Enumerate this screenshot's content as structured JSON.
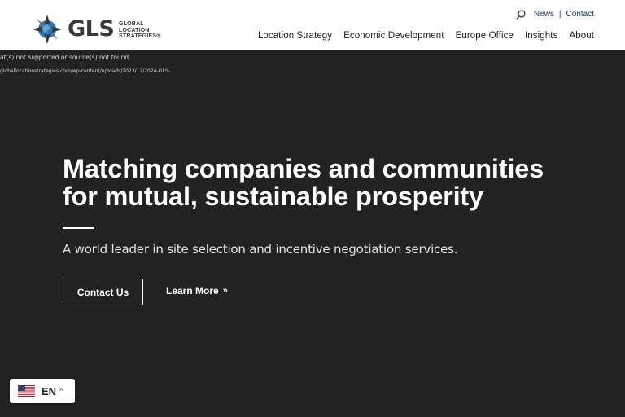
{
  "brand": {
    "name": "GLS",
    "subtitle": [
      "GLOBAL",
      "LOCATION",
      "STRATEGIES®"
    ]
  },
  "utility_nav": {
    "search_icon": "search-icon",
    "items": [
      "News",
      "Contact"
    ],
    "separator": "|"
  },
  "main_nav": {
    "items": [
      "Location Strategy",
      "Economic Development",
      "Europe Office",
      "Insights",
      "About"
    ]
  },
  "broken_image": {
    "line1": "at(s) not supported or source(s) not found",
    "line2": "globallocationstrategies.com/wp-content/uploads/2023/12/2024-GLS-"
  },
  "hero": {
    "title": "Matching companies and communities for mutual, sustainable prosperity",
    "subtitle": "A world leader in site selection and incentive negotiation services.",
    "primary_cta": "Contact Us",
    "secondary_cta": "Learn More",
    "secondary_cta_icon": "»"
  },
  "language": {
    "flag_icon": "us-flag-icon",
    "code": "EN",
    "caret_icon": "^"
  },
  "colors": {
    "background": "#232222",
    "header": "#ffffff",
    "link": "#1a3b6c",
    "logo_blue": "#2d7ab8"
  }
}
